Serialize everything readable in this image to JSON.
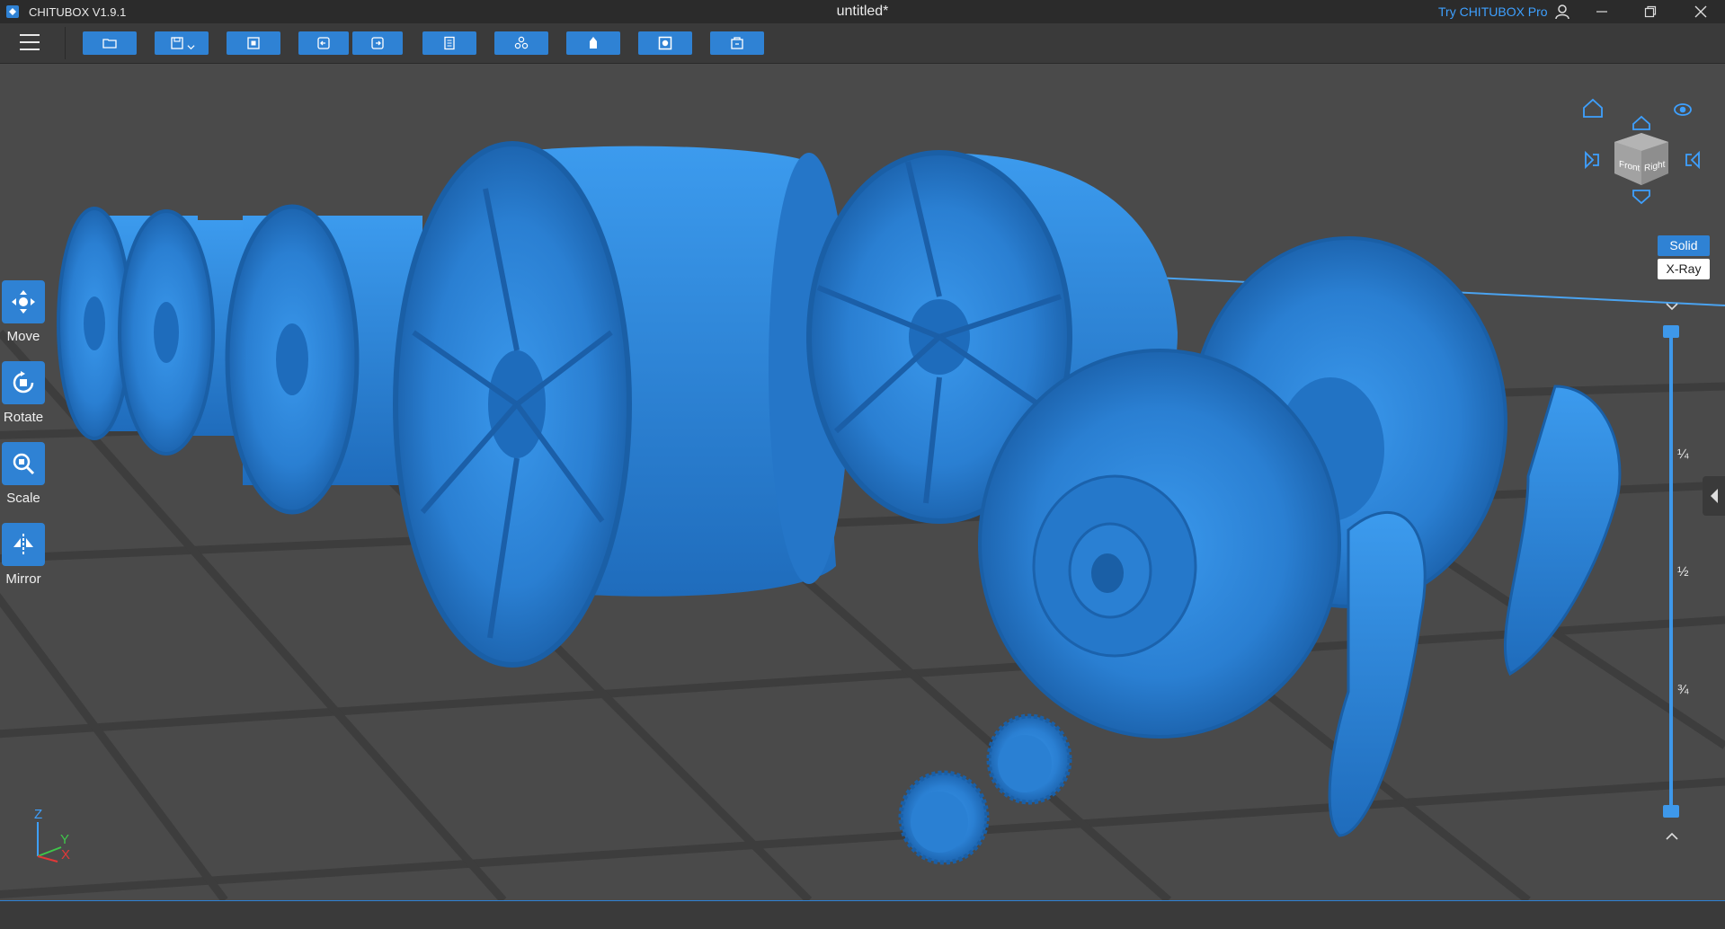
{
  "app": {
    "title": "CHITUBOX V1.9.1",
    "document_title": "untitled*",
    "try_pro_label": "Try CHITUBOX Pro"
  },
  "toolbar": {
    "buttons": [
      {
        "name": "open-file",
        "icon": "folder-icon"
      },
      {
        "name": "save",
        "icon": "save-icon"
      },
      {
        "name": "center-view",
        "icon": "fit-icon"
      },
      {
        "name": "undo",
        "icon": "undo-icon"
      },
      {
        "name": "redo",
        "icon": "redo-icon"
      },
      {
        "name": "settings",
        "icon": "document-icon"
      },
      {
        "name": "arrange",
        "icon": "arrange-icon"
      },
      {
        "name": "support",
        "icon": "support-icon"
      },
      {
        "name": "hollow",
        "icon": "hollow-icon"
      },
      {
        "name": "slice",
        "icon": "slice-icon"
      }
    ]
  },
  "left_tools": [
    {
      "label": "Move",
      "icon": "move-icon"
    },
    {
      "label": "Rotate",
      "icon": "rotate-icon"
    },
    {
      "label": "Scale",
      "icon": "scale-icon"
    },
    {
      "label": "Mirror",
      "icon": "mirror-icon"
    }
  ],
  "view_cube": {
    "front_label": "Front",
    "right_label": "Right"
  },
  "render_modes": {
    "solid_label": "Solid",
    "xray_label": "X-Ray",
    "active": "Solid"
  },
  "layer_slider": {
    "ticks": [
      "¼",
      "½",
      "¾"
    ],
    "top_value_fraction": 1.0,
    "bottom_value_fraction": 0.0
  },
  "axis_gizmo": {
    "z_label": "Z",
    "y_label": "Y",
    "x_label": "X"
  },
  "colors": {
    "accent": "#2f82d4",
    "model": "#2d86dc",
    "background": "#4a4a4a",
    "grid": "#3c3c3c"
  }
}
